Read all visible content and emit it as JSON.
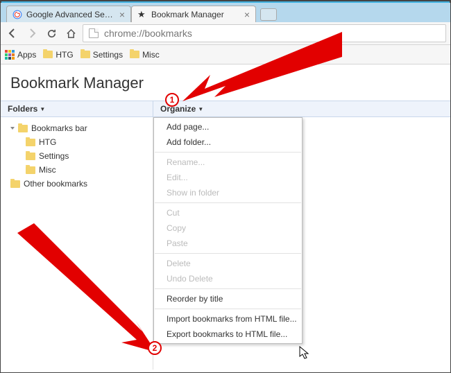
{
  "tabs": [
    {
      "title": "Google Advanced Search",
      "active": false
    },
    {
      "title": "Bookmark Manager",
      "active": true
    }
  ],
  "omnibox": {
    "url": "chrome://bookmarks"
  },
  "bookmarks_bar": {
    "apps_label": "Apps",
    "items": [
      "HTG",
      "Settings",
      "Misc"
    ]
  },
  "page": {
    "title": "Bookmark Manager",
    "folders_label": "Folders",
    "organize_label": "Organize"
  },
  "tree": {
    "root1": "Bookmarks bar",
    "children": [
      "HTG",
      "Settings",
      "Misc"
    ],
    "root2": "Other bookmarks"
  },
  "menu": {
    "add_page": "Add page...",
    "add_folder": "Add folder...",
    "rename": "Rename...",
    "edit": "Edit...",
    "show_in_folder": "Show in folder",
    "cut": "Cut",
    "copy": "Copy",
    "paste": "Paste",
    "delete": "Delete",
    "undo_delete": "Undo Delete",
    "reorder": "Reorder by title",
    "import": "Import bookmarks from HTML file...",
    "export": "Export bookmarks to HTML file..."
  },
  "callouts": {
    "one": "1",
    "two": "2"
  }
}
